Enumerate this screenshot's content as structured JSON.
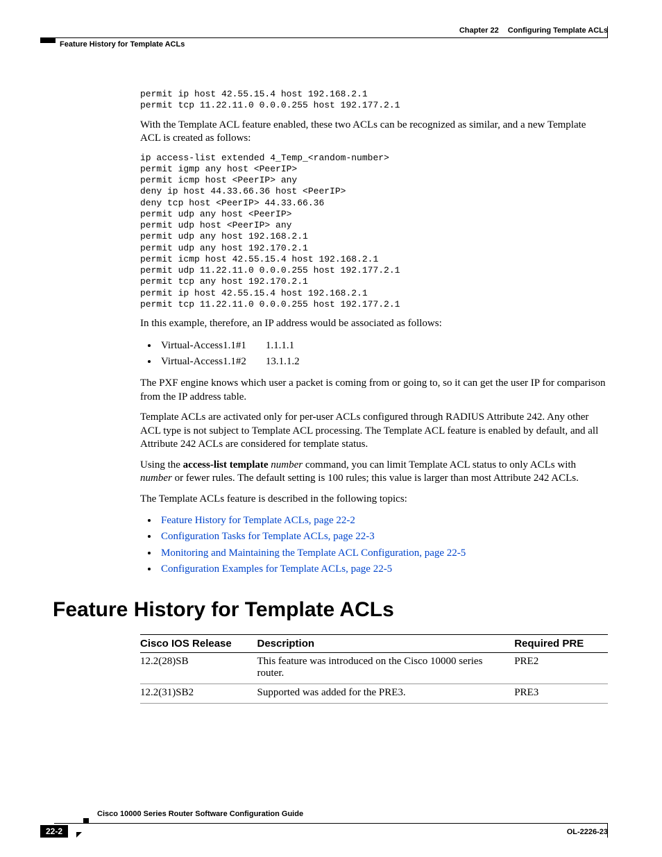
{
  "header": {
    "chapter": "Chapter 22",
    "title": "Configuring Template ACLs",
    "section": "Feature History for Template ACLs"
  },
  "code_block_1": "permit ip host 42.55.15.4 host 192.168.2.1\npermit tcp 11.22.11.0 0.0.0.255 host 192.177.2.1",
  "para1": "With the Template ACL feature enabled, these two ACLs can be recognized as similar, and a new Template ACL is created as follows:",
  "code_block_2": "ip access-list extended 4_Temp_<random-number>\npermit igmp any host <PeerIP>\npermit icmp host <PeerIP> any\ndeny ip host 44.33.66.36 host <PeerIP>\ndeny tcp host <PeerIP> 44.33.66.36\npermit udp any host <PeerIP>\npermit udp host <PeerIP> any\npermit udp any host 192.168.2.1\npermit udp any host 192.170.2.1\npermit icmp host 42.55.15.4 host 192.168.2.1\npermit udp 11.22.11.0 0.0.0.255 host 192.177.2.1\npermit tcp any host 192.170.2.1\npermit ip host 42.55.15.4 host 192.168.2.1\npermit tcp 11.22.11.0 0.0.0.255 host 192.177.2.1",
  "para2": "In this example, therefore, an IP address would be associated as follows:",
  "assoc": [
    {
      "iface": "Virtual-Access1.1#1",
      "ip": "1.1.1.1"
    },
    {
      "iface": "Virtual-Access1.1#2",
      "ip": "13.1.1.2"
    }
  ],
  "para3": "The PXF engine knows which user a packet is coming from or going to, so it can get the user IP for comparison from the IP address table.",
  "para4": "Template ACLs are activated only for per-user ACLs configured through RADIUS Attribute 242. Any other ACL type is not subject to Template ACL processing. The Template ACL feature is enabled by default, and all Attribute 242 ACLs are considered for template status.",
  "para5": {
    "pre": "Using the ",
    "bold": "access-list template",
    "ital1": " number",
    "mid": " command, you can limit Template ACL status to only ACLs with ",
    "ital2": "number",
    "post": " or fewer rules. The default setting is 100 rules; this value is larger than most Attribute 242 ACLs."
  },
  "para6": "The Template ACLs feature is described in the following topics:",
  "topics": [
    "Feature History for Template ACLs, page 22-2",
    "Configuration Tasks for Template ACLs, page 22-3",
    "Monitoring and Maintaining the Template ACL Configuration, page 22-5",
    "Configuration Examples for Template ACLs, page 22-5"
  ],
  "h1": "Feature History for Template ACLs",
  "table": {
    "headers": [
      "Cisco IOS Release",
      "Description",
      "Required PRE"
    ],
    "rows": [
      {
        "rel": "12.2(28)SB",
        "desc": "This feature was introduced on the Cisco 10000 series router.",
        "pre": "PRE2"
      },
      {
        "rel": "12.2(31)SB2",
        "desc": "Supported was added for the PRE3.",
        "pre": "PRE3"
      }
    ]
  },
  "footer": {
    "guide": "Cisco 10000 Series Router Software Configuration Guide",
    "page": "22-2",
    "docid": "OL-2226-23"
  }
}
